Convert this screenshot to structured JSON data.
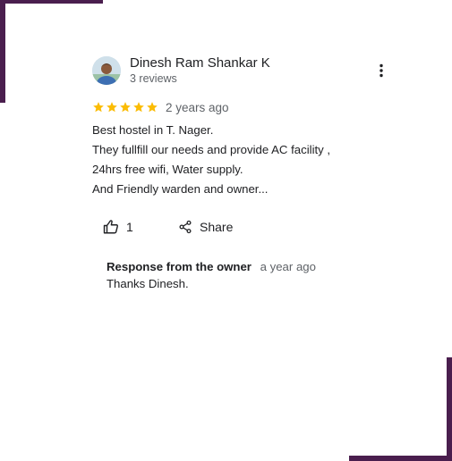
{
  "review": {
    "reviewer_name": "Dinesh Ram Shankar K",
    "review_count": "3 reviews",
    "rating": 5,
    "date": "2 years ago",
    "text_lines": [
      "Best hostel in T. Nager.",
      "They fullfill our needs and provide AC facility ,",
      "24hrs free wifi, Water supply.",
      "And Friendly warden and owner..."
    ],
    "like_count": "1",
    "share_label": "Share"
  },
  "owner_response": {
    "title": "Response from the owner",
    "date": "a year ago",
    "text": "Thanks Dinesh."
  },
  "colors": {
    "star": "#fbbc04",
    "accent_frame": "#4a1e4e",
    "secondary_text": "#5f6368"
  },
  "icons": [
    "avatar",
    "more-vert-icon",
    "star-icon",
    "thumb-up-icon",
    "share-icon"
  ]
}
